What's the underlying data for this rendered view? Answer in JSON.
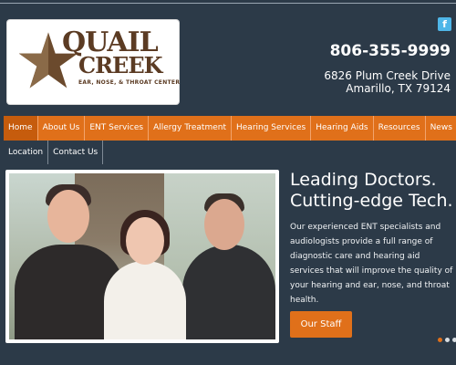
{
  "logo": {
    "line1": "QUAIL",
    "line2": "CREEK",
    "subtitle": "EAR, NOSE, & THROAT CENTER"
  },
  "social": {
    "facebook_label": "f"
  },
  "contact": {
    "phone": "806-355-9999",
    "address_line1": "6826 Plum Creek Drive",
    "address_line2": "Amarillo, TX 79124"
  },
  "nav": {
    "items": [
      "Home",
      "About Us",
      "ENT Services",
      "Allergy Treatment",
      "Hearing Services",
      "Hearing Aids",
      "Resources",
      "News"
    ],
    "items_row2": [
      "Location",
      "Contact Us"
    ],
    "active": "Home"
  },
  "hero": {
    "headline_line1": "Leading Doctors.",
    "headline_line2": "Cutting-edge Tech.",
    "body": "Our experienced ENT specialists and audiologists provide a full range of diagnostic care and hearing aid services that will improve the quality of your hearing and ear, nose, and throat health.",
    "cta_label": "Our Staff",
    "slides": 3,
    "active_slide": 1
  },
  "colors": {
    "background": "#2c3a48",
    "accent": "#e0701a",
    "logo_brown": "#5b3b23",
    "facebook": "#4fb6e8"
  }
}
